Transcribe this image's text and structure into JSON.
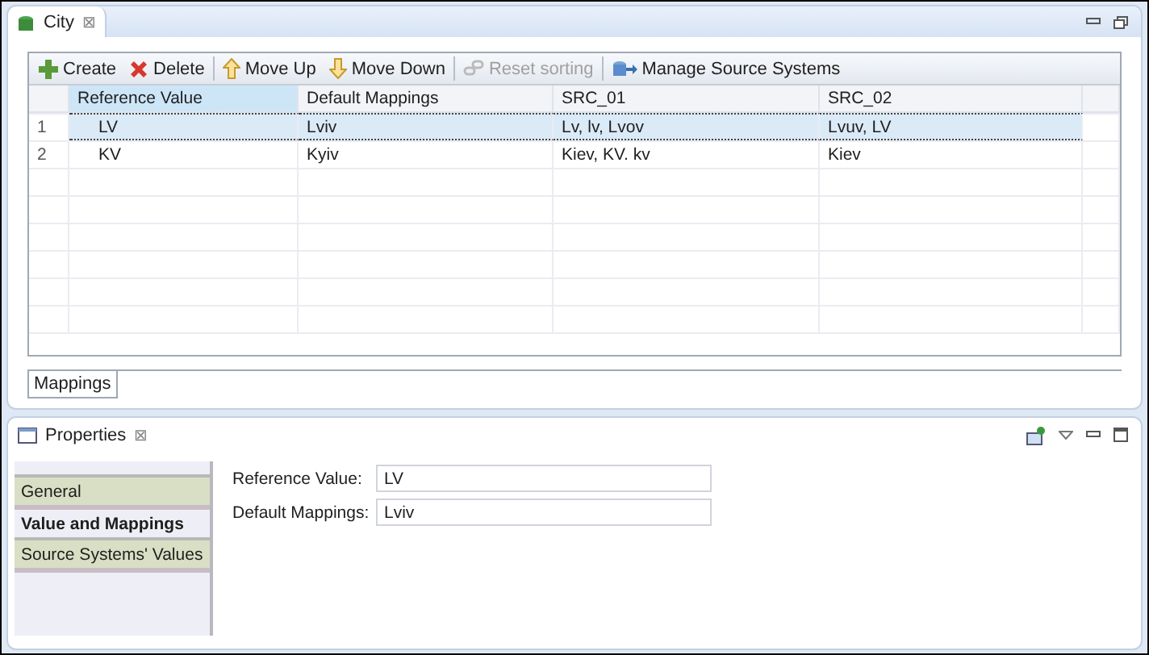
{
  "editor": {
    "tab": {
      "label": "City",
      "close": "⊠"
    },
    "toolbar": [
      {
        "label": "Create",
        "disabled": false
      },
      {
        "label": "Delete",
        "disabled": false
      },
      {
        "label": "Move Up",
        "disabled": false
      },
      {
        "label": "Move Down",
        "disabled": false
      },
      {
        "label": "Reset sorting",
        "disabled": true
      },
      {
        "label": "Manage Source Systems",
        "disabled": false
      }
    ],
    "table": {
      "columns": [
        "Reference Value",
        "Default Mappings",
        "SRC_01",
        "SRC_02"
      ],
      "rows": [
        {
          "number": "1",
          "cells": [
            "LV",
            "Lviv",
            "Lv, lv, Lvov",
            "Lvuv, LV"
          ],
          "selected": true
        },
        {
          "number": "2",
          "cells": [
            "KV",
            "Kyiv",
            "Kiev, KV. kv",
            "Kiev"
          ],
          "selected": false
        }
      ]
    },
    "bottom_tabs": [
      {
        "label": "Mappings",
        "selected": true
      }
    ]
  },
  "properties": {
    "tab": {
      "label": "Properties",
      "close": "⊠"
    },
    "sections": [
      {
        "label": "General",
        "selected": false
      },
      {
        "label": "Value and Mappings",
        "selected": true
      },
      {
        "label": "Source Systems' Values",
        "selected": false
      }
    ],
    "fields": [
      {
        "label": "Reference Value:",
        "value": "LV"
      },
      {
        "label": "Default Mappings:",
        "value": "Lviv"
      }
    ]
  }
}
